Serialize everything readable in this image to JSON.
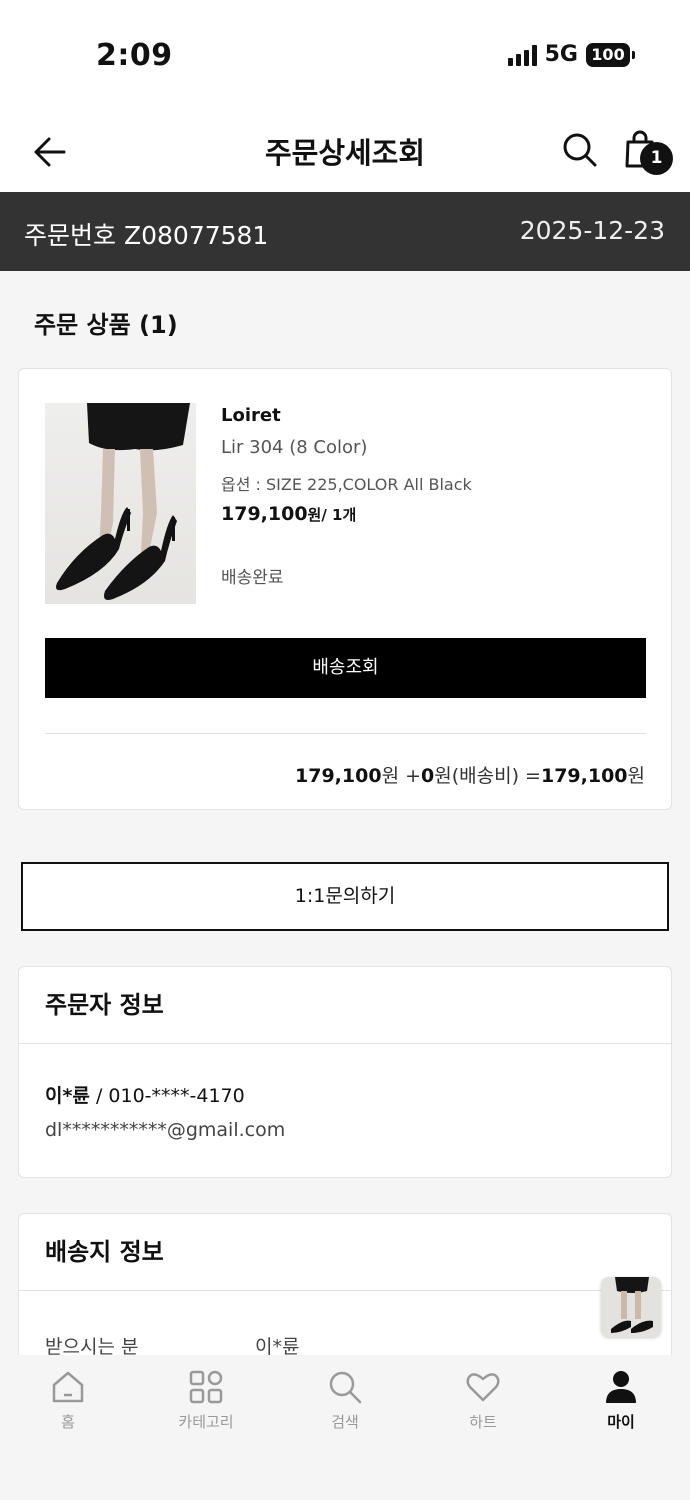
{
  "status_bar": {
    "time": "2:09",
    "network": "5G",
    "battery": "100"
  },
  "header": {
    "title": "주문상세조회",
    "cart_count": "1"
  },
  "order": {
    "label": "주문번호",
    "number": "Z08077581",
    "date": "2025-12-23"
  },
  "products_section": {
    "title": "주문 상품 (1)"
  },
  "product": {
    "brand": "Loiret",
    "name": "Lir 304 (8 Color)",
    "option": "옵션 : SIZE 225,COLOR All Black",
    "price": "179,100",
    "price_unit": "원",
    "quantity": "/ 1개",
    "status": "배송완료",
    "track_button": "배송조회"
  },
  "totals": {
    "items": "179,100",
    "items_unit": "원 +",
    "shipping": "0",
    "shipping_label": "원(배송비) =",
    "grand": "179,100",
    "grand_unit": "원"
  },
  "inquiry_button": "1:1문의하기",
  "orderer_info": {
    "title": "주문자 정보",
    "name": "이*륜",
    "phone": " / 010-****-4170",
    "email": "dl***********@gmail.com"
  },
  "shipping_info": {
    "title": "배송지 정보",
    "recipient_label": "받으시는 분",
    "recipient_value": "이*륜"
  },
  "tabbar": {
    "items": [
      {
        "label": "홈",
        "icon": "home-icon"
      },
      {
        "label": "카테고리",
        "icon": "category-icon"
      },
      {
        "label": "검색",
        "icon": "search-icon"
      },
      {
        "label": "하트",
        "icon": "heart-icon"
      },
      {
        "label": "마이",
        "icon": "person-icon"
      }
    ]
  }
}
